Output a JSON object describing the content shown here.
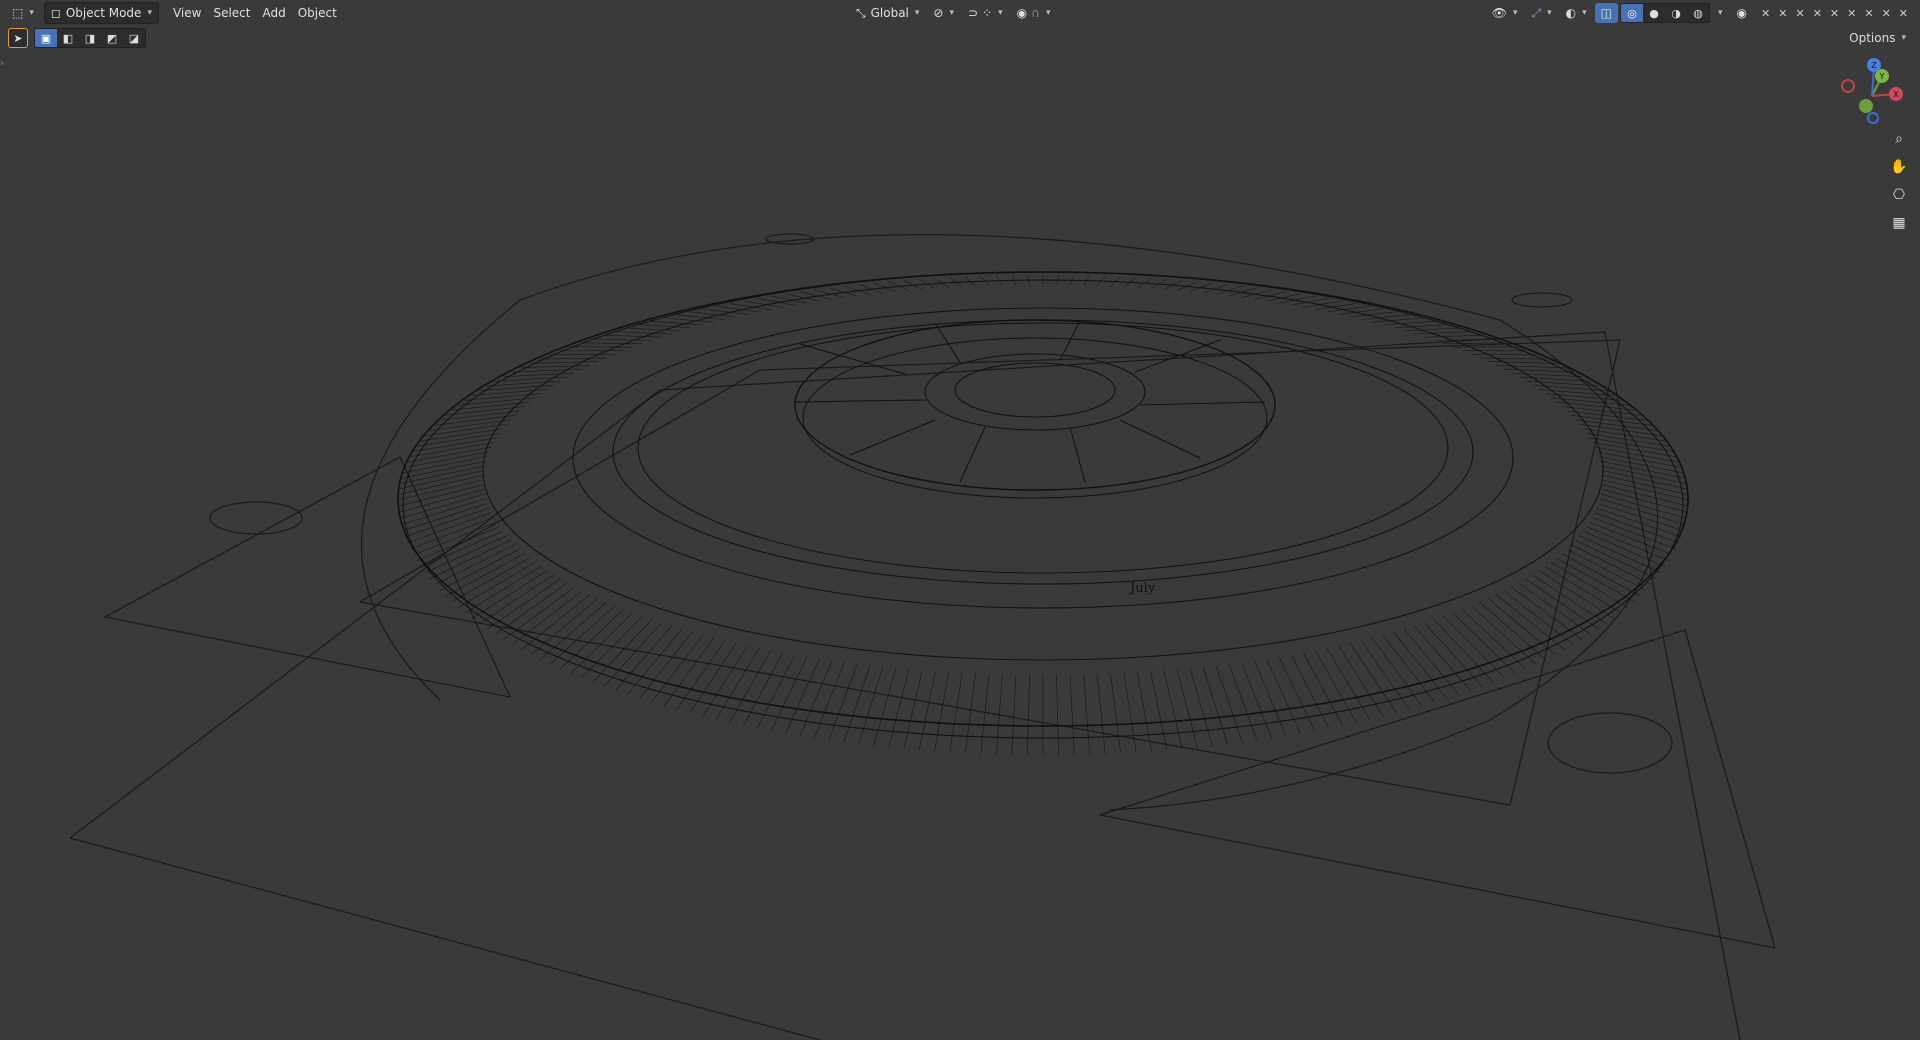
{
  "header": {
    "editor_type_icon": "view3d-icon",
    "mode_label": "Object Mode",
    "menus": [
      "View",
      "Select",
      "Add",
      "Object"
    ],
    "transform_orientation": "Global",
    "pivot_icon": "pivot-icon",
    "snap_icon": "magnet-icon",
    "proportional_icon": "proportional-icon",
    "right_icons": [
      "visibility-icon",
      "gizmo-icon",
      "overlay-icon",
      "xray-icon",
      "shading-wireframe",
      "shading-solid",
      "shading-material",
      "shading-rendered"
    ]
  },
  "toolbar": {
    "select_modes": [
      "select-new-icon",
      "select-extend-icon",
      "select-subtract-icon",
      "select-invert-icon",
      "select-intersect-icon"
    ]
  },
  "options_label": "Options",
  "gizmo": {
    "axes": [
      "X",
      "Y",
      "Z"
    ]
  },
  "viewport": {
    "labels": [
      "July"
    ],
    "colors": {
      "background": "#3a3a3a",
      "wire": "#111111",
      "accent": "#4772b3"
    }
  }
}
